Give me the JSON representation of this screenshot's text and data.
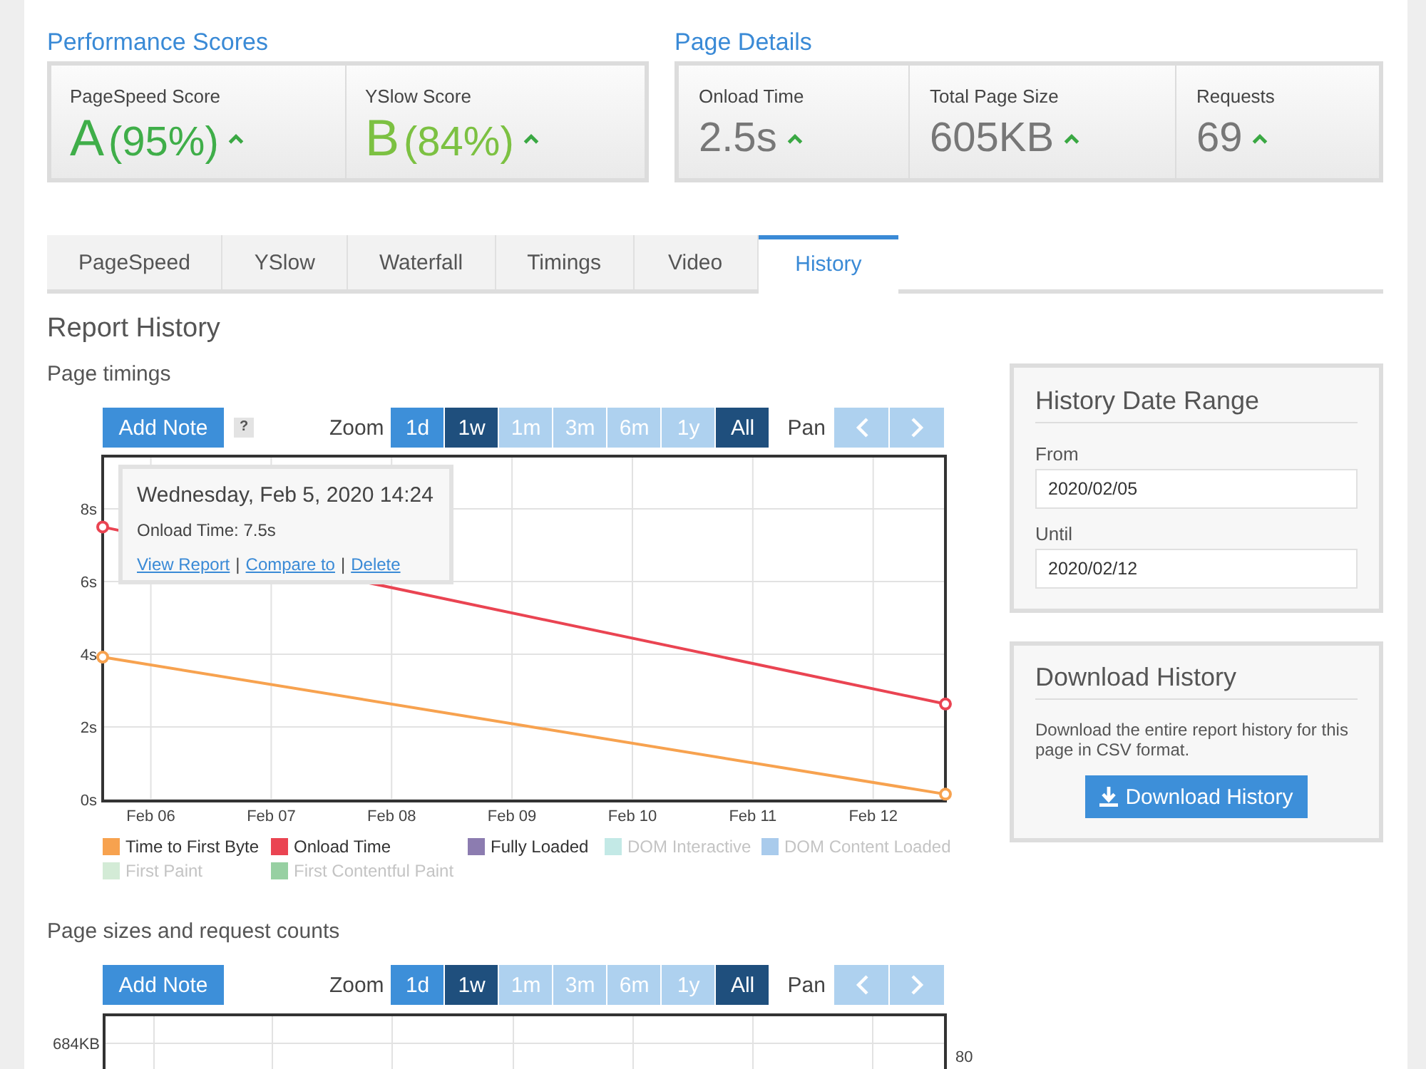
{
  "performance_scores": {
    "title": "Performance Scores",
    "scores": [
      {
        "label": "PageSpeed Score",
        "grade": "A",
        "percent": "(95%)",
        "color": "#3fae49"
      },
      {
        "label": "YSlow Score",
        "grade": "B",
        "percent": "(84%)",
        "color": "#7cc142"
      }
    ]
  },
  "page_details": {
    "title": "Page Details",
    "metrics": [
      {
        "label": "Onload Time",
        "value": "2.5s"
      },
      {
        "label": "Total Page Size",
        "value": "605KB"
      },
      {
        "label": "Requests",
        "value": "69"
      }
    ]
  },
  "tabs": [
    {
      "label": "PageSpeed",
      "selected": false
    },
    {
      "label": "YSlow",
      "selected": false
    },
    {
      "label": "Waterfall",
      "selected": false
    },
    {
      "label": "Timings",
      "selected": false
    },
    {
      "label": "Video",
      "selected": false
    },
    {
      "label": "History",
      "selected": true
    }
  ],
  "report_history": {
    "title": "Report History",
    "page_timings": {
      "title": "Page timings",
      "toolbar": {
        "add_note": "Add Note",
        "help": "?",
        "zoom_label": "Zoom",
        "zoom_buttons": [
          {
            "label": "1d",
            "selected": false,
            "disabled": false
          },
          {
            "label": "1w",
            "selected": true,
            "disabled": false
          },
          {
            "label": "1m",
            "selected": false,
            "disabled": true
          },
          {
            "label": "3m",
            "selected": false,
            "disabled": true
          },
          {
            "label": "6m",
            "selected": false,
            "disabled": true
          },
          {
            "label": "1y",
            "selected": false,
            "disabled": true
          },
          {
            "label": "All",
            "selected": true,
            "disabled": false
          }
        ],
        "pan_label": "Pan",
        "pan_buttons": [
          {
            "kind": "left",
            "disabled": true
          },
          {
            "kind": "right",
            "disabled": true
          }
        ]
      },
      "chart_data": {
        "type": "line",
        "grid": true,
        "categories": [
          null,
          null,
          "Feb 06",
          null,
          null,
          null,
          null,
          "Feb 07",
          null,
          null,
          null,
          null,
          "Feb 08",
          null,
          null,
          null,
          null,
          "Feb 09",
          null,
          null,
          null,
          null,
          "Feb 10",
          null,
          null,
          null,
          null,
          "Feb 11",
          null,
          null,
          null,
          null,
          "Feb 12",
          null,
          null,
          null
        ],
        "ylim": [
          0,
          9.45
        ],
        "yticks": [
          {
            "value": 0,
            "label": "0s"
          },
          {
            "value": 2,
            "label": "2s"
          },
          {
            "value": 4,
            "label": "4s"
          },
          {
            "value": 6,
            "label": "6s"
          },
          {
            "value": 8,
            "label": "8s"
          }
        ],
        "series": [
          {
            "name": "Time to First Byte",
            "color": "#f7a24f",
            "marker": "circle",
            "values": [
              3.92,
              null,
              null,
              null,
              null,
              null,
              null,
              null,
              null,
              null,
              null,
              null,
              null,
              null,
              null,
              null,
              null,
              null,
              null,
              null,
              null,
              null,
              null,
              null,
              null,
              null,
              null,
              null,
              null,
              null,
              null,
              null,
              null,
              null,
              null,
              0.15
            ]
          },
          {
            "name": "Onload Time",
            "color": "#ea4452",
            "marker": "circle",
            "values": [
              7.5,
              null,
              null,
              null,
              null,
              null,
              null,
              null,
              null,
              null,
              null,
              null,
              null,
              null,
              null,
              null,
              null,
              null,
              null,
              null,
              null,
              null,
              null,
              null,
              null,
              null,
              null,
              null,
              null,
              null,
              null,
              null,
              null,
              null,
              null,
              2.63
            ]
          },
          {
            "name": "Fully Loaded",
            "color": "#8c7cb0",
            "values": [
              null,
              null,
              null,
              null,
              null,
              null,
              null,
              null,
              null,
              null,
              null,
              null,
              null,
              null,
              null,
              null,
              null,
              null,
              null,
              null,
              null,
              null,
              null,
              null,
              null,
              null,
              null,
              null,
              null,
              null,
              null,
              null,
              null,
              null,
              null,
              null
            ]
          },
          {
            "name": "DOM Interactive",
            "color": "#c3e9e6",
            "values": [
              null,
              null,
              null,
              null,
              null,
              null,
              null,
              null,
              null,
              null,
              null,
              null,
              null,
              null,
              null,
              null,
              null,
              null,
              null,
              null,
              null,
              null,
              null,
              null,
              null,
              null,
              null,
              null,
              null,
              null,
              null,
              null,
              null,
              null,
              null,
              null
            ]
          },
          {
            "name": "DOM Content Loaded",
            "color": "#a9cbec",
            "values": [
              null,
              null,
              null,
              null,
              null,
              null,
              null,
              null,
              null,
              null,
              null,
              null,
              null,
              null,
              null,
              null,
              null,
              null,
              null,
              null,
              null,
              null,
              null,
              null,
              null,
              null,
              null,
              null,
              null,
              null,
              null,
              null,
              null,
              null,
              null,
              null
            ]
          },
          {
            "name": "First Paint",
            "color": "#d3ebd6",
            "values": [
              null,
              null,
              null,
              null,
              null,
              null,
              null,
              null,
              null,
              null,
              null,
              null,
              null,
              null,
              null,
              null,
              null,
              null,
              null,
              null,
              null,
              null,
              null,
              null,
              null,
              null,
              null,
              null,
              null,
              null,
              null,
              null,
              null,
              null,
              null,
              null
            ]
          },
          {
            "name": "First Contentful Paint",
            "color": "#97d0a2",
            "values": [
              null,
              null,
              null,
              null,
              null,
              null,
              null,
              null,
              null,
              null,
              null,
              null,
              null,
              null,
              null,
              null,
              null,
              null,
              null,
              null,
              null,
              null,
              null,
              null,
              null,
              null,
              null,
              null,
              null,
              null,
              null,
              null,
              null,
              null,
              null,
              null
            ]
          }
        ]
      },
      "legend": [
        {
          "hidden": false
        },
        {
          "hidden": false
        },
        {
          "hidden": false
        },
        {
          "hidden": true
        },
        {
          "hidden": true
        },
        {
          "hidden": true
        },
        {
          "hidden": true
        }
      ],
      "tooltip": {
        "title": "Wednesday, Feb 5, 2020 14:24",
        "text": "Onload Time: 7.5s",
        "links": [
          "View Report",
          "Compare to",
          "Delete"
        ],
        "separator": "|"
      }
    },
    "page_sizes": {
      "title": "Page sizes and request counts",
      "toolbar": {
        "add_note": "Add Note",
        "zoom_label": "Zoom",
        "zoom_buttons": [
          {
            "label": "1d",
            "selected": false,
            "disabled": false
          },
          {
            "label": "1w",
            "selected": true,
            "disabled": false
          },
          {
            "label": "1m",
            "selected": false,
            "disabled": true
          },
          {
            "label": "3m",
            "selected": false,
            "disabled": true
          },
          {
            "label": "6m",
            "selected": false,
            "disabled": true
          },
          {
            "label": "1y",
            "selected": false,
            "disabled": true
          },
          {
            "label": "All",
            "selected": true,
            "disabled": false
          }
        ],
        "pan_label": "Pan",
        "pan_buttons": [
          {
            "kind": "left",
            "disabled": true
          },
          {
            "kind": "right",
            "disabled": true
          }
        ]
      },
      "left_axis_label": "684KB",
      "right_axis_label": "80"
    }
  },
  "sidebar": {
    "date_range": {
      "title": "History Date Range",
      "fields": [
        {
          "label": "From",
          "value": "2020/02/05"
        },
        {
          "label": "Until",
          "value": "2020/02/12"
        }
      ]
    },
    "download": {
      "title": "Download History",
      "text": "Download the entire report history for this page in CSV format.",
      "button": "Download History"
    }
  }
}
